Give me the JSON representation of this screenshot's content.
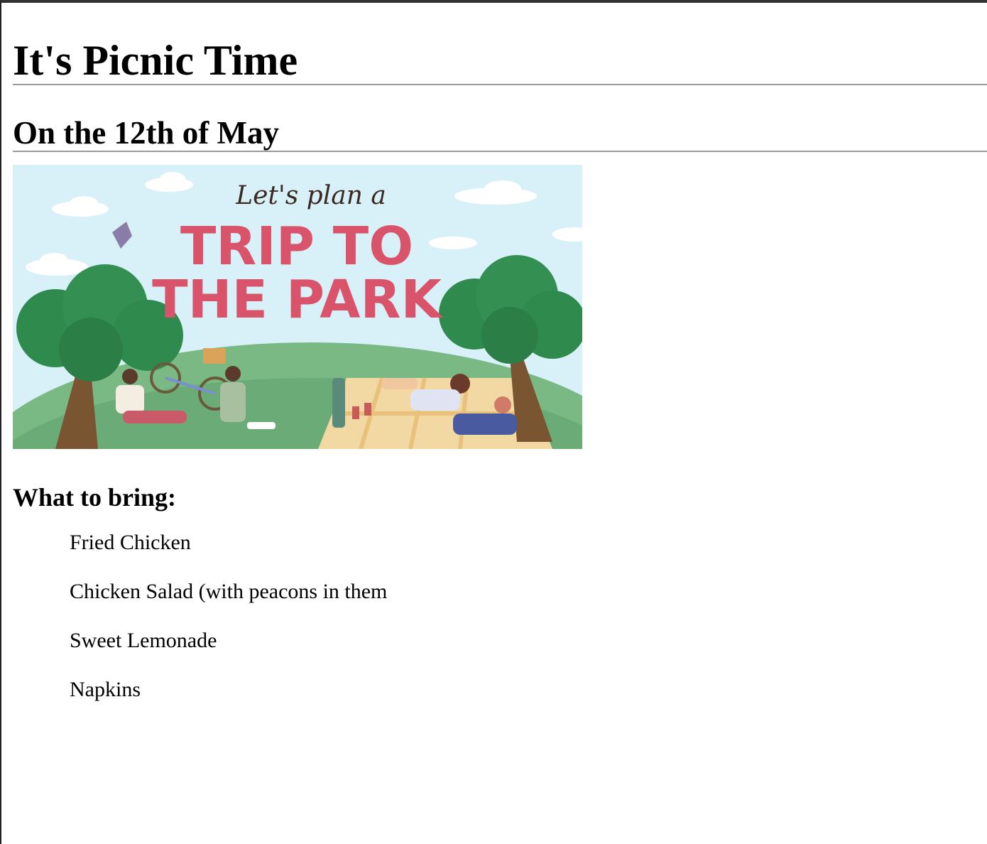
{
  "page": {
    "title": "It's Picnic Time",
    "date_heading": "On the 12th of May"
  },
  "banner": {
    "tagline": "Let's plan a",
    "headline_line1": "TRIP TO",
    "headline_line2": "THE PARK",
    "colors": {
      "sky": "#d8f0f8",
      "headline": "#d9546a",
      "grass": "#7ab884",
      "tree": "#2f8a4e"
    }
  },
  "bring": {
    "heading": "What to bring:",
    "items": [
      "Fried Chicken",
      "Chicken Salad (with peacons in them",
      "Sweet Lemonade",
      "Napkins"
    ]
  }
}
